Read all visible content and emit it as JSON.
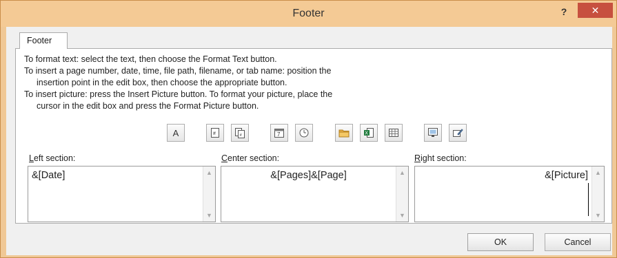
{
  "window": {
    "title": "Footer",
    "help_label": "?",
    "close_label": "✕"
  },
  "tab": {
    "label": "Footer"
  },
  "instructions": {
    "line1": "To format text:  select the text, then choose the Format Text button.",
    "line2": "To insert a page number, date, time, file path, filename, or tab name:  position the",
    "line3": "insertion point in the edit box, then choose the appropriate button.",
    "line4": "To insert picture: press the Insert Picture button.  To format your picture, place the",
    "line5": "cursor in the edit box and press the Format Picture button."
  },
  "toolbar": {
    "format_text_label": "A",
    "buttons": [
      "format-text-icon",
      "insert-page-number-icon",
      "insert-number-of-pages-icon",
      "insert-date-icon",
      "insert-time-icon",
      "insert-file-path-icon",
      "insert-file-name-icon",
      "insert-sheet-name-icon",
      "insert-picture-icon",
      "format-picture-icon"
    ]
  },
  "sections": {
    "left": {
      "label_accel": "L",
      "label_rest": "eft section:",
      "value": "&[Date]"
    },
    "center": {
      "label_accel": "C",
      "label_rest": "enter section:",
      "value": "&[Pages]&[Page]"
    },
    "right": {
      "label_accel": "R",
      "label_rest": "ight section:",
      "value": "&[Picture]"
    }
  },
  "buttons": {
    "ok": "OK",
    "cancel": "Cancel"
  },
  "colors": {
    "titlebar": "#f4ca95",
    "close": "#c7503f",
    "dialog_bg": "#f0f0f0"
  }
}
